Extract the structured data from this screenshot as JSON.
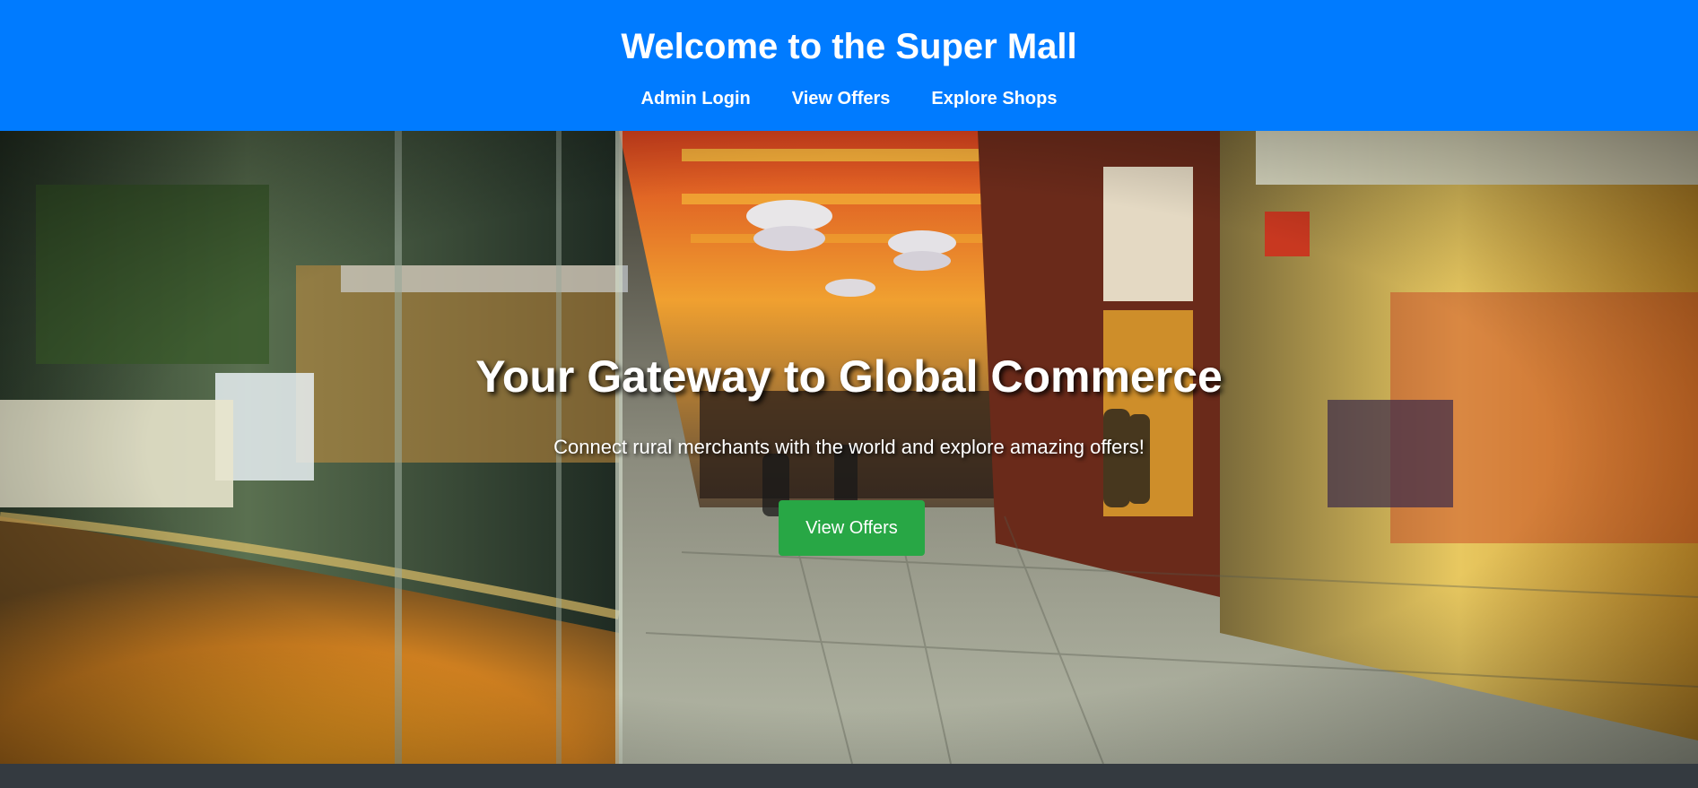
{
  "header": {
    "title": "Welcome to the Super Mall",
    "background_color": "#007bff",
    "nav": [
      {
        "label": "Admin Login"
      },
      {
        "label": "View Offers"
      },
      {
        "label": "Explore Shops"
      }
    ]
  },
  "hero": {
    "background_image": "shopping-mall-interior-photo",
    "heading": "Your Gateway to Global Commerce",
    "subheading": "Connect rural merchants with the world and explore amazing offers!",
    "cta_label": "View Offers",
    "cta_color": "#28a745"
  },
  "footer": {
    "background_color": "#343a40"
  }
}
